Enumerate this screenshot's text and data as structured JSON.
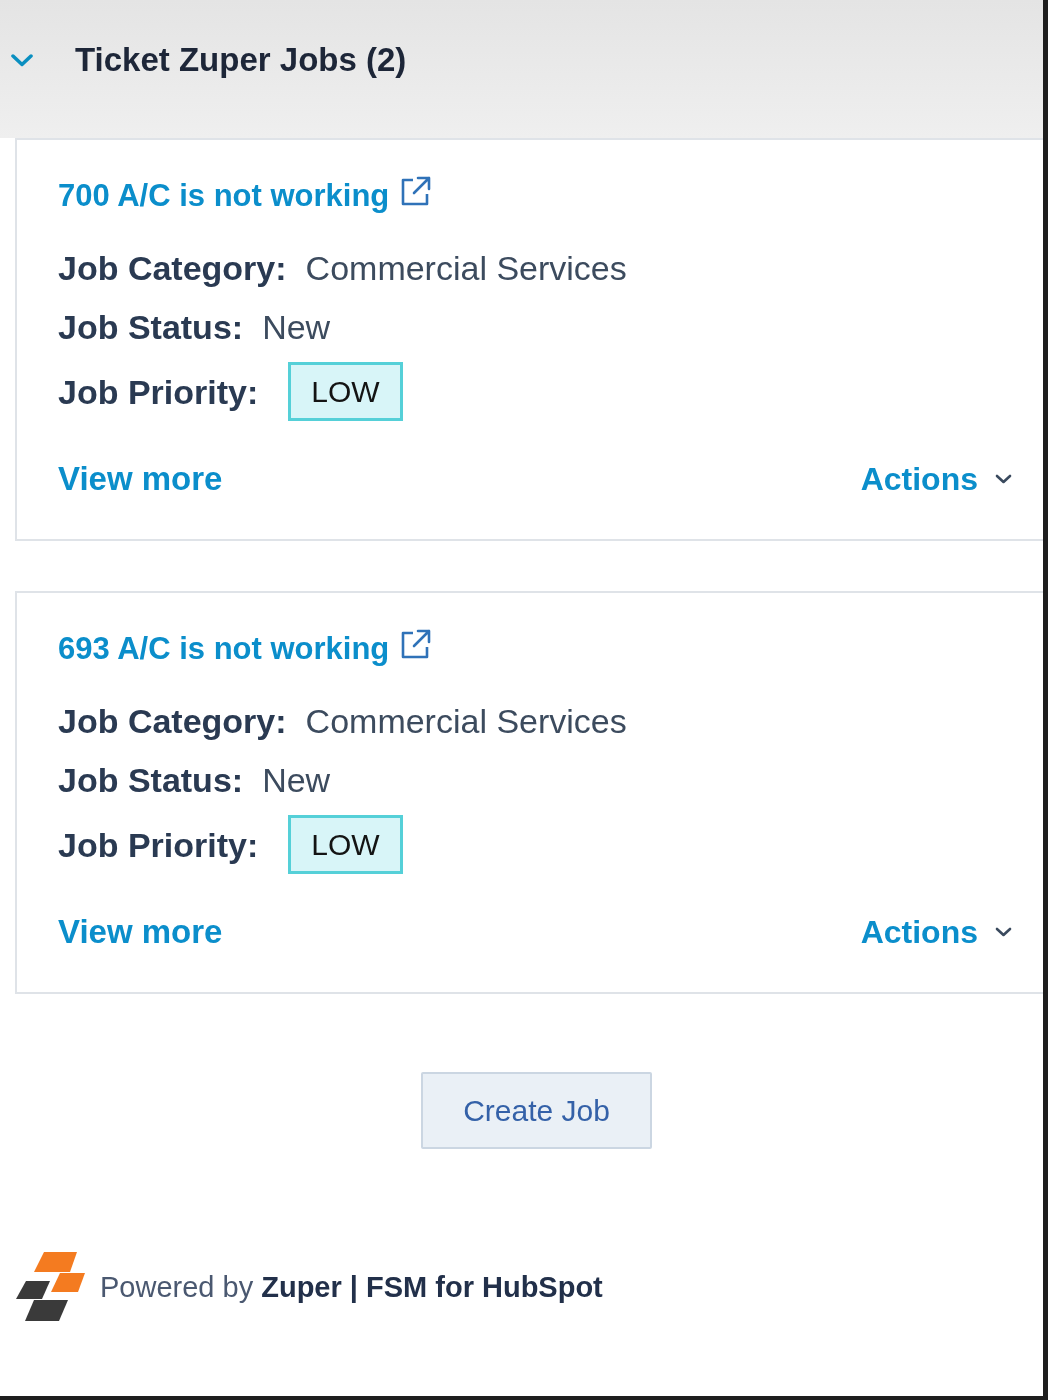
{
  "section": {
    "title": "Ticket Zuper Jobs (2)",
    "expanded": true
  },
  "jobs": [
    {
      "title": "700 A/C is not working",
      "fields": [
        {
          "kind": "text",
          "label": "Job Category:",
          "value": "Commercial Services"
        },
        {
          "kind": "text",
          "label": "Job Status:",
          "value": "New"
        },
        {
          "kind": "badge",
          "label": "Job Priority:",
          "value": "LOW"
        }
      ],
      "view_more": "View more",
      "actions": "Actions"
    },
    {
      "title": "693 A/C is not working",
      "fields": [
        {
          "kind": "text",
          "label": "Job Category:",
          "value": "Commercial Services"
        },
        {
          "kind": "text",
          "label": "Job Status:",
          "value": "New"
        },
        {
          "kind": "badge",
          "label": "Job Priority:",
          "value": "LOW"
        }
      ],
      "view_more": "View more",
      "actions": "Actions"
    }
  ],
  "create_button": "Create Job",
  "footer": {
    "text": "Powered by **Zuper | FSM for HubSpot**"
  }
}
